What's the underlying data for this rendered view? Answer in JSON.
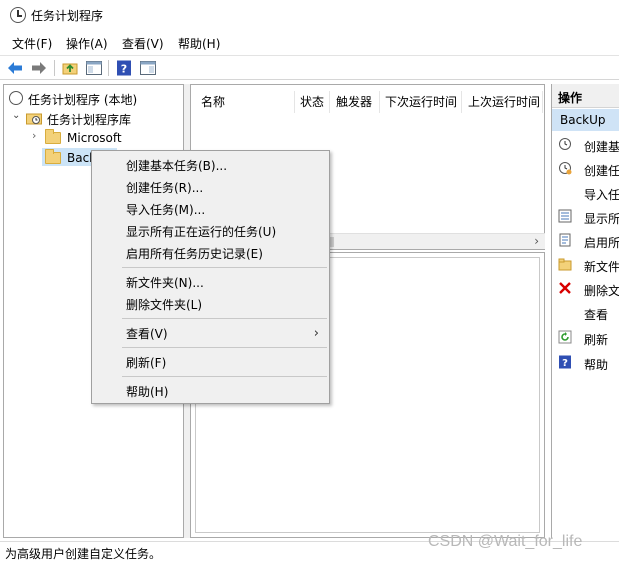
{
  "window": {
    "title": "任务计划程序"
  },
  "menubar": [
    {
      "label": "文件(F)"
    },
    {
      "label": "操作(A)"
    },
    {
      "label": "查看(V)"
    },
    {
      "label": "帮助(H)"
    }
  ],
  "tree": {
    "root": "任务计划程序 (本地)",
    "library": "任务计划程序库",
    "folders": [
      "Microsoft",
      "Backup"
    ]
  },
  "columns": [
    "名称",
    "状态",
    "触发器",
    "下次运行时间",
    "上次运行时间"
  ],
  "actions": {
    "header": "操作",
    "selected": "BackUp",
    "items": [
      {
        "label": "创建基",
        "icon": "clock-icon"
      },
      {
        "label": "创建任",
        "icon": "clock-gear-icon"
      },
      {
        "label": "导入任",
        "icon": "none"
      },
      {
        "label": "显示所",
        "icon": "list-icon"
      },
      {
        "label": "启用所",
        "icon": "history-icon"
      },
      {
        "label": "新文件",
        "icon": "folder-icon"
      },
      {
        "label": "删除文",
        "icon": "delete-x-icon"
      },
      {
        "label": "查看",
        "icon": "none"
      },
      {
        "label": "刷新",
        "icon": "refresh-icon"
      },
      {
        "label": "帮助",
        "icon": "help-icon"
      }
    ]
  },
  "context_menu": {
    "items": [
      "创建基本任务(B)...",
      "创建任务(R)...",
      "导入任务(M)...",
      "显示所有正在运行的任务(U)",
      "启用所有任务历史记录(E)",
      "新文件夹(N)...",
      "删除文件夹(L)",
      "查看(V)",
      "刷新(F)",
      "帮助(H)"
    ]
  },
  "status": "为高级用户创建自定义任务。",
  "watermark": "CSDN @Wait_for_life",
  "colors": {
    "selection": "#cfe3f6",
    "delete": "#d80000",
    "help": "#2f4fb3"
  }
}
